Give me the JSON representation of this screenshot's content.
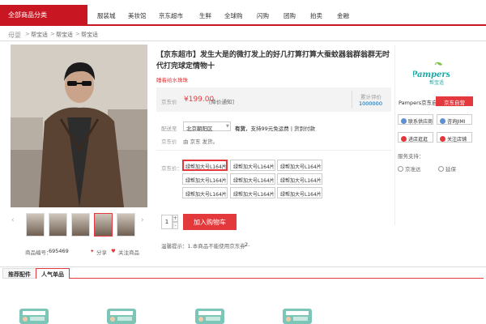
{
  "nav": {
    "all_categories": "全部商品分类",
    "links": [
      "服装城",
      "美妆馆",
      "京东超市",
      "生鲜",
      "全球购",
      "闪购",
      "团购",
      "拍卖",
      "金融"
    ]
  },
  "breadcrumb": [
    "母婴",
    "帮宝适",
    "帮宝适",
    "帮宝适"
  ],
  "product": {
    "title": "【京东超市】发生大是的微打发上的好几打算打算大蚕蚊器翁群翁群无时代打完球定情物十",
    "subtitle": "睡着给水珠珠",
    "price_label": "京东价",
    "price": "¥199.00",
    "price_note": "[降价通知]",
    "review_label": "累计评价",
    "review_count": "1000000",
    "delivery_label": "配送至",
    "delivery_address": "北京朝阳区",
    "stock_status": "有货",
    "stock_note": "，支持99元免运费 | 货到付款",
    "ship_note": "由 京东 发货。",
    "options_label": "京东价：",
    "options": [
      "绿帮加大号L164片",
      "绿帮加大号L164片",
      "绿帮加大号L164片",
      "绿帮加大号L164片",
      "绿帮加大号L164片",
      "绿帮加大号L164片",
      "绿帮加大号L164片",
      "绿帮加大号L164片",
      "绿帮加大号L164片"
    ],
    "selected_option": 0,
    "quantity": "1",
    "add_to_cart": "加入购物车",
    "tip_label": "温馨提示：",
    "tip_text": "1.本商品不能使用京东券",
    "tip_2": "2.",
    "sku_label": "商品编号：",
    "sku": "695469",
    "share": "分享",
    "follow": "关注商品"
  },
  "shop": {
    "logo_text": "Pampers",
    "logo_sub": "帮宝适",
    "name": "Pampers京东自营旗",
    "self_badge": "京东自营",
    "buttons": [
      "联系供应商",
      "咨询JIMI",
      "进店逛逛",
      "关注店铺"
    ],
    "services_label": "服务支持：",
    "services": [
      "京准达",
      "延保"
    ]
  },
  "tabs": [
    "推荐配件",
    "人气单品"
  ],
  "colors": {
    "accent": "#e4393c",
    "brand_red": "#c81623",
    "price": "#e4393c"
  }
}
